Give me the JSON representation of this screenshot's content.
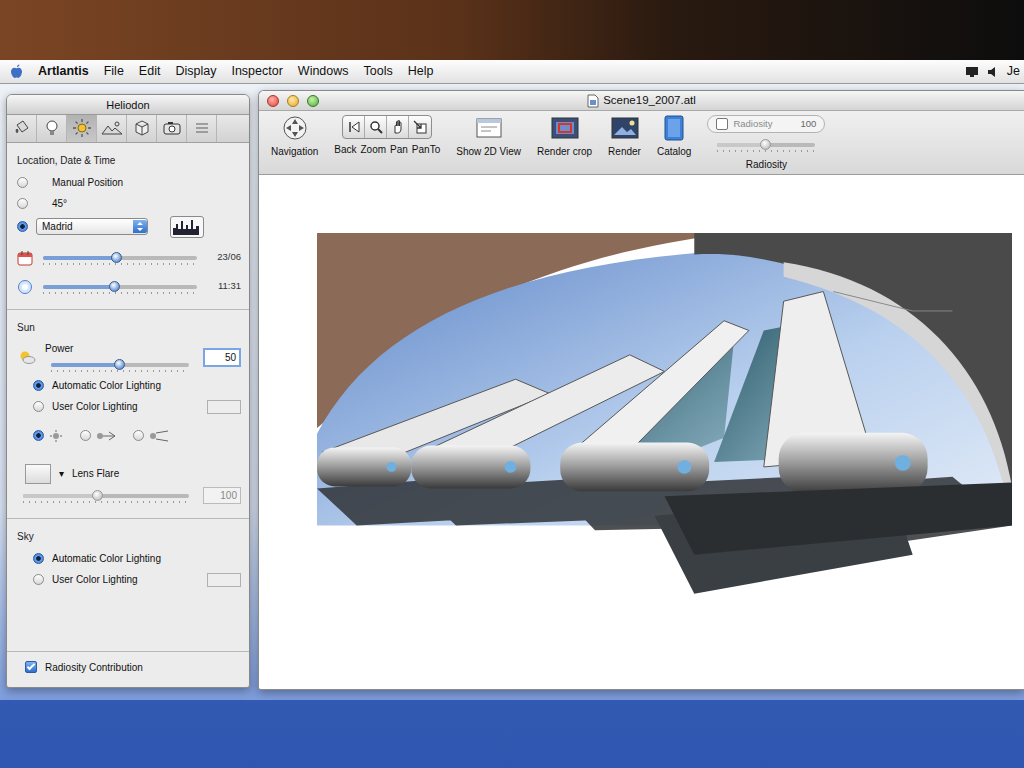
{
  "menubar": {
    "app": "Artlantis",
    "items": [
      "File",
      "Edit",
      "Display",
      "Inspector",
      "Windows",
      "Tools",
      "Help"
    ],
    "user": "Je"
  },
  "palette": {
    "title": "Heliodon",
    "tools": [
      {
        "selected": false
      },
      {
        "selected": false
      },
      {
        "selected": true
      },
      {
        "selected": false
      },
      {
        "selected": false
      },
      {
        "selected": false
      },
      {
        "selected": false
      }
    ],
    "location": {
      "heading": "Location, Date & Time",
      "options": [
        {
          "kind": "text",
          "label": "Manual Position",
          "selected": false
        },
        {
          "kind": "text",
          "label": "45°",
          "selected": false
        },
        {
          "kind": "select",
          "label": "Madrid",
          "selected": true
        }
      ],
      "date": {
        "reading": "23/06",
        "level": 0.48
      },
      "time": {
        "reading": "11:31",
        "level": 0.47
      }
    },
    "sun": {
      "heading": "Sun",
      "power": {
        "label": "Power",
        "level": 0.5,
        "value": "50"
      },
      "lighting": [
        {
          "kind": "auto",
          "label": "Automatic Color Lighting",
          "selected": true
        },
        {
          "kind": "user",
          "label": "User Color Lighting",
          "selected": false
        }
      ],
      "modes": [
        {
          "selected": true
        },
        {
          "selected": false
        },
        {
          "selected": false
        }
      ],
      "lens_flare": {
        "label": "Lens Flare",
        "arrow": "▾",
        "level": 0.45,
        "value": "100",
        "disabled": true
      }
    },
    "sky": {
      "heading": "Sky",
      "lighting": [
        {
          "kind": "auto",
          "label": "Automatic Color Lighting",
          "selected": true
        },
        {
          "kind": "user",
          "label": "User Color Lighting",
          "selected": false
        }
      ]
    },
    "radiosity_contribution": {
      "label": "Radiosity Contribution",
      "checked": true
    }
  },
  "window": {
    "title": "Scene19_2007.atl"
  },
  "toolbar": {
    "navigation": "Navigation",
    "view_tools": [
      "Back",
      "Zoom",
      "Pan",
      "PanTo"
    ],
    "items": [
      "Show 2D View",
      "Render crop",
      "Render",
      "Catalog"
    ],
    "radiosity": {
      "field_label": "Radiosity",
      "checked": false,
      "value": "100",
      "level": 0.5,
      "label": "Radiosity",
      "disabled": true
    }
  }
}
